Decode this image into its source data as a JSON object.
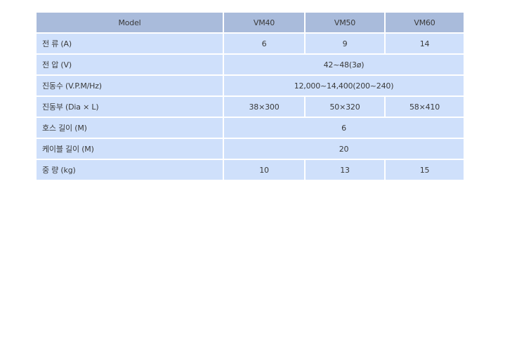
{
  "table": {
    "header": {
      "model": "Model",
      "vm40": "VM40",
      "vm50": "VM50",
      "vm60": "VM60"
    },
    "rows": {
      "current": {
        "label": "전 류 (A)",
        "vm40": "6",
        "vm50": "9",
        "vm60": "14"
      },
      "voltage": {
        "label": "전 압 (V)",
        "all": "42~48(3ø)"
      },
      "vibration": {
        "label": "진동수 (V.P.M/Hz)",
        "all": "12,000~14,400(200~240)"
      },
      "vibrator": {
        "label": "진동부 (Dia × L)",
        "vm40": "38×300",
        "vm50": "50×320",
        "vm60": "58×410"
      },
      "hose_length": {
        "label": "호스 길이 (M)",
        "all": "6"
      },
      "cable_length": {
        "label": "케이블 길이 (M)",
        "all": "20"
      },
      "weight": {
        "label": "중 량 (kg)",
        "vm40": "10",
        "vm50": "13",
        "vm60": "15"
      }
    }
  }
}
